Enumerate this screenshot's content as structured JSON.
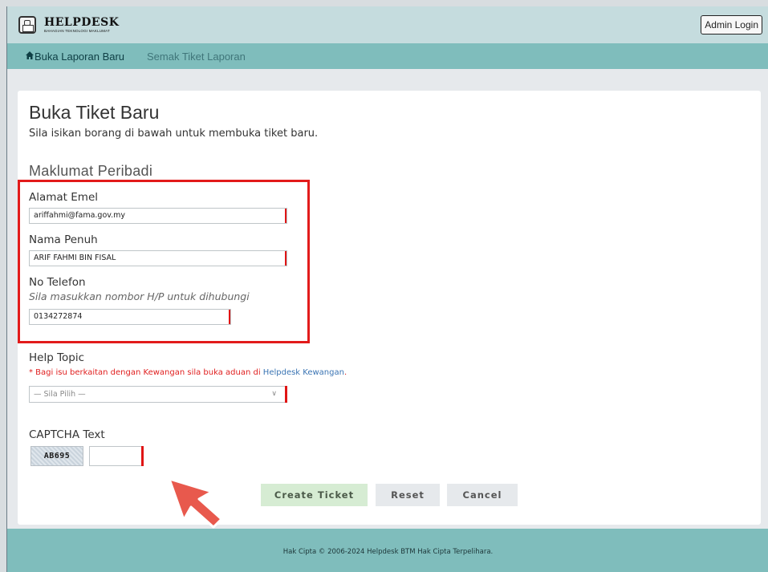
{
  "header": {
    "logo_title": "HELPDESK",
    "logo_subtitle": "BAHAGIAN TEKNOLOGI MAKLUMAT",
    "admin_login_label": "Admin Login"
  },
  "nav": {
    "home_icon": "home-icon",
    "items": [
      {
        "label": "Buka Laporan Baru"
      },
      {
        "label": "Semak Tiket Laporan"
      }
    ]
  },
  "form": {
    "title": "Buka Tiket Baru",
    "description": "Sila isikan borang di bawah untuk membuka tiket baru.",
    "section_title": "Maklumat Peribadi",
    "email": {
      "label": "Alamat Emel",
      "value": "ariffahmi@fama.gov.my"
    },
    "name": {
      "label": "Nama Penuh",
      "value": "ARIF FAHMI BIN FISAL"
    },
    "phone": {
      "label": "No Telefon",
      "hint": "Sila masukkan nombor H/P  untuk dihubungi",
      "value": "0134272874"
    },
    "help_topic": {
      "label": "Help Topic",
      "note_prefix": "* Bagi isu berkaitan dengan Kewangan sila buka aduan di ",
      "note_link": "Helpdesk Kewangan",
      "note_suffix": ".",
      "selected": "— Sila Pilih —"
    },
    "captcha": {
      "label": "CAPTCHA Text",
      "code": "AB695",
      "value": ""
    },
    "buttons": {
      "create": "Create Ticket",
      "reset": "Reset",
      "cancel": "Cancel"
    }
  },
  "footer": {
    "text": "Hak Cipta © 2006-2024 Helpdesk BTM Hak Cipta Terpelihara."
  },
  "colors": {
    "topbar": "#c5dcde",
    "navbar": "#7fbdbc",
    "highlight": "#e21b1b",
    "required": "#e01515",
    "create_button": "#d6ecd3"
  }
}
